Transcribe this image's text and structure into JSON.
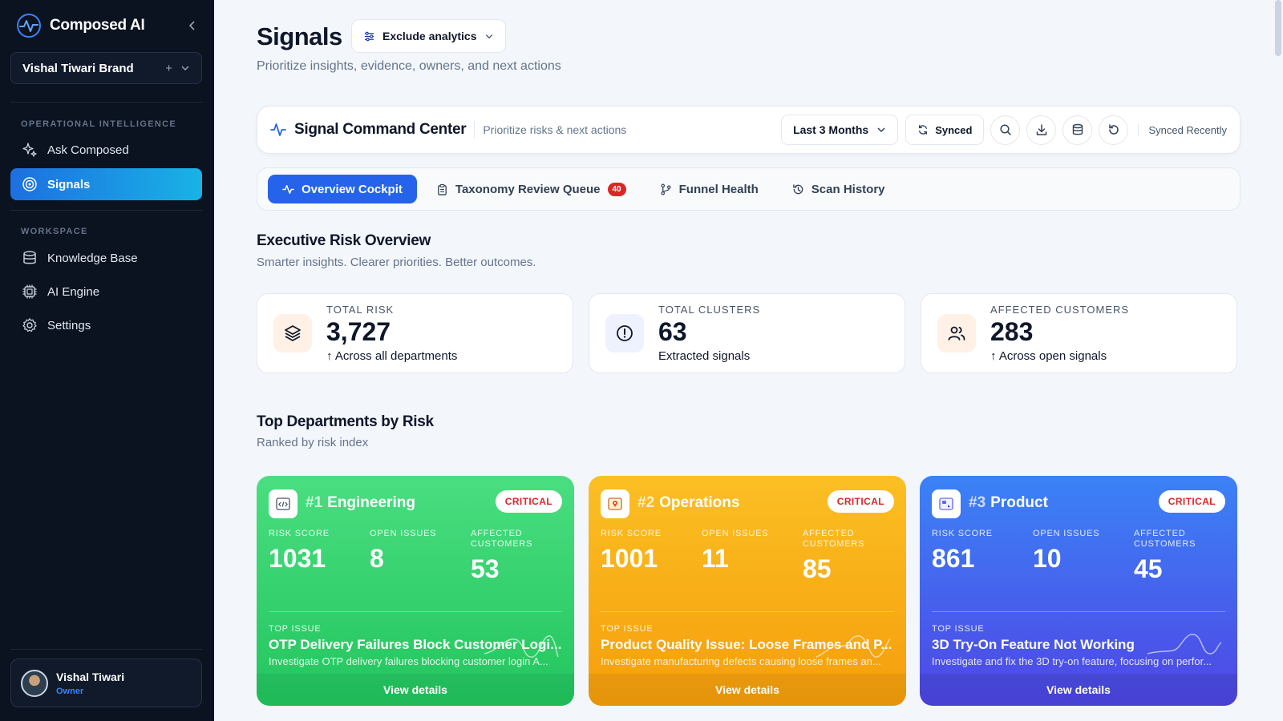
{
  "sidebar": {
    "brand": "Composed AI",
    "workspace_selector": "Vishal Tiwari Brand",
    "sections": [
      {
        "label": "OPERATIONAL INTELLIGENCE",
        "items": [
          {
            "label": "Ask Composed",
            "icon": "sparkles-icon"
          },
          {
            "label": "Signals",
            "icon": "radar-icon",
            "active": true
          }
        ]
      },
      {
        "label": "WORKSPACE",
        "items": [
          {
            "label": "Knowledge Base",
            "icon": "database-icon"
          },
          {
            "label": "AI Engine",
            "icon": "cpu-icon"
          },
          {
            "label": "Settings",
            "icon": "gear-icon"
          }
        ]
      }
    ],
    "user": {
      "name": "Vishal Tiwari",
      "role": "Owner"
    }
  },
  "header": {
    "title": "Signals",
    "filter_label": "Exclude analytics",
    "subtitle": "Prioritize insights, evidence, owners, and next actions"
  },
  "command_center": {
    "title": "Signal Command Center",
    "subtitle": "Prioritize risks & next actions",
    "range_label": "Last 3 Months",
    "sync_label": "Synced",
    "status": "Synced Recently"
  },
  "tabs": [
    {
      "label": "Overview Cockpit",
      "active": true
    },
    {
      "label": "Taxonomy Review Queue",
      "badge": "40"
    },
    {
      "label": "Funnel Health"
    },
    {
      "label": "Scan History"
    }
  ],
  "overview": {
    "title": "Executive Risk Overview",
    "subtitle": "Smarter insights. Clearer priorities. Better outcomes.",
    "stats": [
      {
        "label": "TOTAL RISK",
        "value": "3,727",
        "note": "Across all departments",
        "icon": "layers-icon",
        "color": "#fff1e6"
      },
      {
        "label": "TOTAL CLUSTERS",
        "value": "63",
        "note": "Extracted signals",
        "icon": "alert-circle-icon",
        "color": "#eef2ff"
      },
      {
        "label": "AFFECTED CUSTOMERS",
        "value": "283",
        "note": "Across open signals",
        "icon": "users-icon",
        "color": "#fff1e6"
      }
    ]
  },
  "departments": {
    "title": "Top Departments by Risk",
    "subtitle": "Ranked by risk index",
    "metric_labels": {
      "risk": "RISK SCORE",
      "issues": "OPEN ISSUES",
      "customers": "AFFECTED CUSTOMERS",
      "top": "TOP ISSUE",
      "view": "View details"
    },
    "items": [
      {
        "rank": "#1",
        "name": "Engineering",
        "severity": "CRITICAL",
        "risk": "1031",
        "issues": "8",
        "customers": "53",
        "top_title": "OTP Delivery Failures Block Customer Logi...",
        "top_desc": "Investigate OTP delivery failures blocking customer login A...",
        "theme": "green"
      },
      {
        "rank": "#2",
        "name": "Operations",
        "severity": "CRITICAL",
        "risk": "1001",
        "issues": "11",
        "customers": "85",
        "top_title": "Product Quality Issue: Loose Frames and P...",
        "top_desc": "Investigate manufacturing defects causing loose frames an...",
        "theme": "orange"
      },
      {
        "rank": "#3",
        "name": "Product",
        "severity": "CRITICAL",
        "risk": "861",
        "issues": "10",
        "customers": "45",
        "top_title": "3D Try-On Feature Not Working",
        "top_desc": "Investigate and fix the 3D try-on feature, focusing on perfor...",
        "theme": "blue"
      }
    ]
  }
}
